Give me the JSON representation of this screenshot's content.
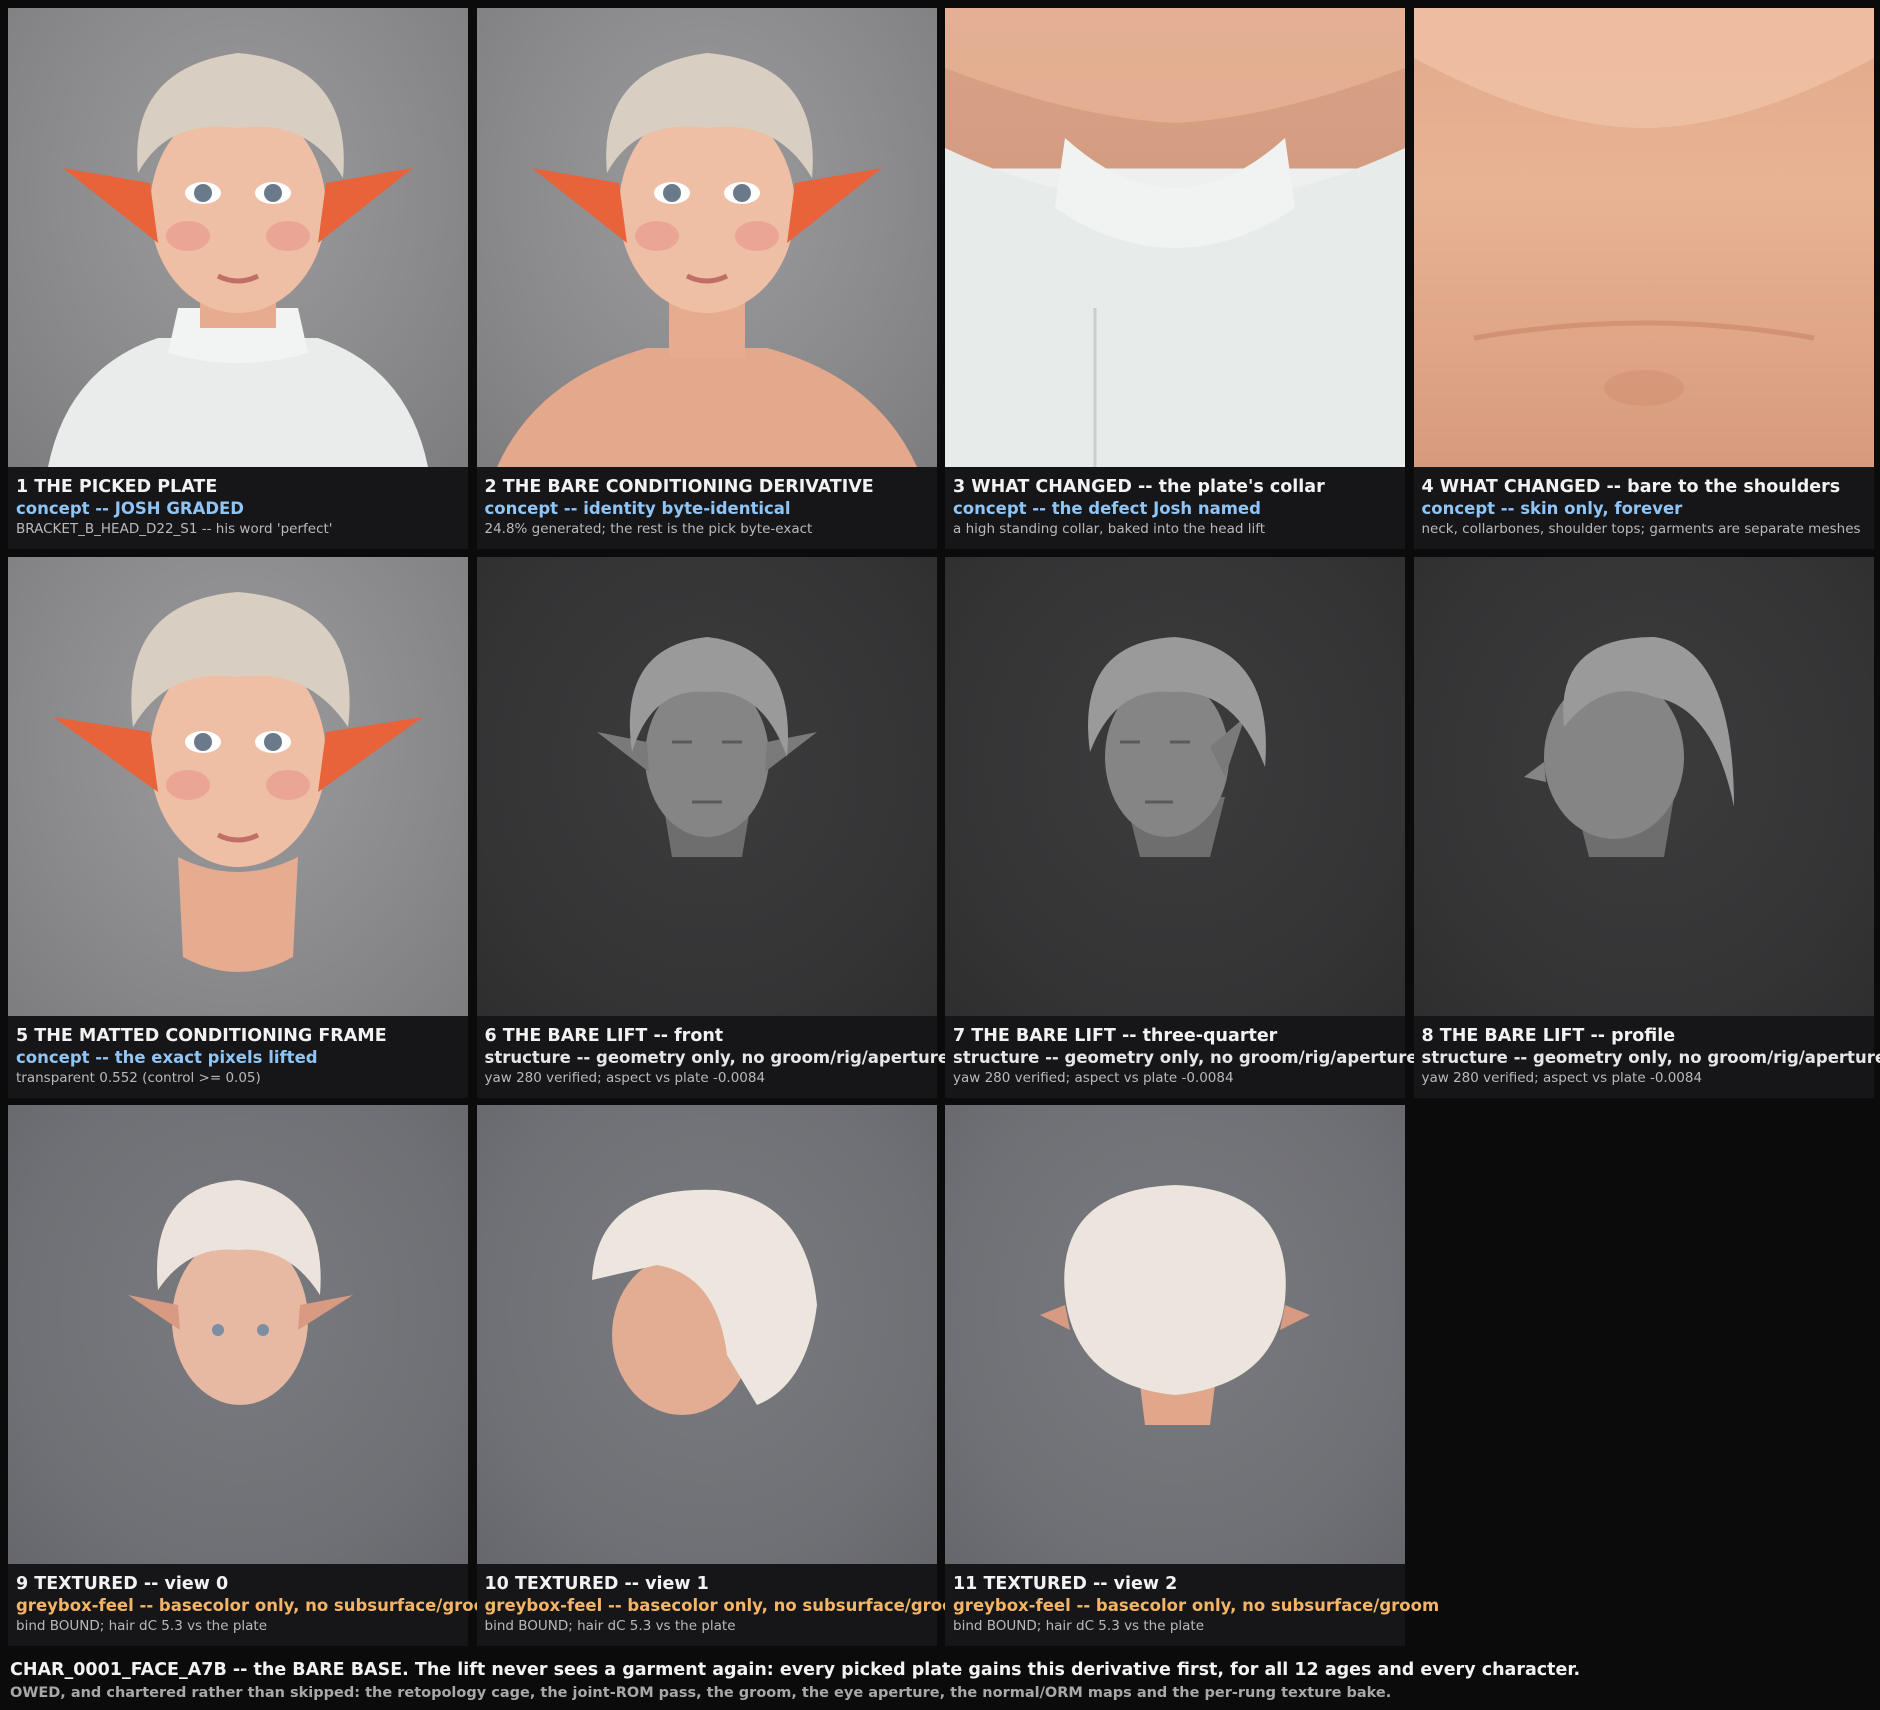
{
  "tiles": [
    {
      "title": "1  THE PICKED PLATE",
      "line2": "concept -- JOSH GRADED",
      "line3": "BRACKET_B_HEAD_D22_S1 -- his word 'perfect'"
    },
    {
      "title": "2  THE BARE CONDITIONING DERIVATIVE",
      "line2": "concept -- identity byte-identical",
      "line3": "24.8% generated; the rest is the pick byte-exact"
    },
    {
      "title": "3  WHAT CHANGED -- the plate's collar",
      "line2": "concept -- the defect Josh named",
      "line3": "a high standing collar, baked into the head lift"
    },
    {
      "title": "4  WHAT CHANGED -- bare to the shoulders",
      "line2": "concept -- skin only, forever",
      "line3": "neck, collarbones, shoulder tops; garments are separate meshes"
    },
    {
      "title": "5  THE MATTED CONDITIONING FRAME",
      "line2": "concept -- the exact pixels lifted",
      "line3": "transparent 0.552 (control >= 0.05)"
    },
    {
      "title": "6  THE BARE LIFT -- front",
      "line2": "structure -- geometry only, no groom/rig/aperture",
      "line3": "yaw 280 verified; aspect vs plate -0.0084"
    },
    {
      "title": "7  THE BARE LIFT -- three-quarter",
      "line2": "structure -- geometry only, no groom/rig/aperture",
      "line3": "yaw 280 verified; aspect vs plate -0.0084"
    },
    {
      "title": "8  THE BARE LIFT -- profile",
      "line2": "structure -- geometry only, no groom/rig/aperture",
      "line3": "yaw 280 verified; aspect vs plate -0.0084"
    },
    {
      "title": "9  TEXTURED -- view 0",
      "line2": "greybox-feel -- basecolor only, no subsurface/groom",
      "line3": "bind BOUND; hair dC 5.3 vs the plate"
    },
    {
      "title": "10  TEXTURED -- view 1",
      "line2": "greybox-feel -- basecolor only, no subsurface/groom",
      "line3": "bind BOUND; hair dC 5.3 vs the plate"
    },
    {
      "title": "11  TEXTURED -- view 2",
      "line2": "greybox-feel -- basecolor only, no subsurface/groom",
      "line3": "bind BOUND; hair dC 5.3 vs the plate"
    }
  ],
  "footer": {
    "line1": "CHAR_0001_FACE_A7B -- the BARE BASE. The lift never sees a garment again: every picked plate gains this derivative first, for all 12 ages and every character.",
    "line2": "OWED, and chartered rather than skipped: the retopology cage, the joint-ROM pass, the groom, the eye aperture, the normal/ORM maps and the per-rung texture bake."
  },
  "colors": {
    "concept": "#8fc4f6",
    "structure": "#e6e6e6",
    "greybox": "#f3b565",
    "caption_bg": "#161618",
    "page_bg": "#0b0b0c"
  }
}
